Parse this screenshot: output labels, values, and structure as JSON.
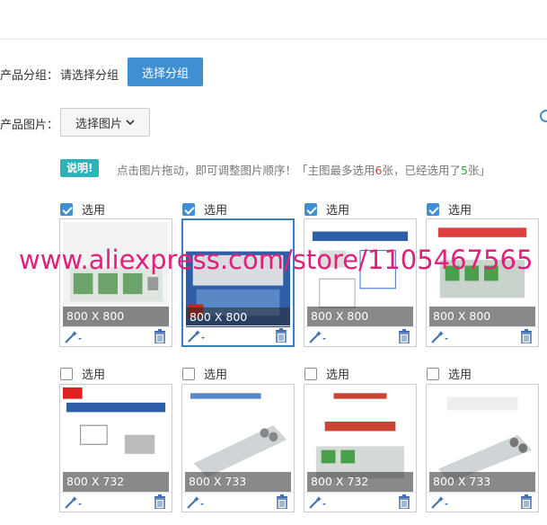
{
  "form": {
    "group_label": "产品分组：",
    "group_placeholder": "请选择分组",
    "group_button": "选择分组",
    "image_label": "产品图片：",
    "image_button": "选择图片"
  },
  "hint": {
    "badge": "说明!",
    "text_a": "点击图片拖动，即可调整图片顺序！「主图最多选用",
    "max_count": "6",
    "text_b": "张，已经选用了",
    "used_count": "5",
    "text_c": "张」"
  },
  "watermark": "www.aliexpress.com/store/1105467565",
  "select_label": "选用",
  "images": [
    {
      "checked": true,
      "size": "800 X 800",
      "selected": false
    },
    {
      "checked": true,
      "size": "800 X 800",
      "selected": true
    },
    {
      "checked": true,
      "size": "800 X 800",
      "selected": false
    },
    {
      "checked": true,
      "size": "800 X 800",
      "selected": false
    },
    {
      "checked": false,
      "size": "800 X 732",
      "selected": false
    },
    {
      "checked": false,
      "size": "800 X 733",
      "selected": false
    },
    {
      "checked": false,
      "size": "800 X 732",
      "selected": false
    },
    {
      "checked": false,
      "size": "800 X 733",
      "selected": false
    }
  ],
  "icons": {
    "edit": "magic-wand-icon",
    "delete": "trash-icon",
    "dropdown": "chevron-down-icon"
  },
  "colors": {
    "primary": "#3f8fd2",
    "badge": "#2bb3b8",
    "highlight_red": "#e4393c",
    "highlight_green": "#36a335",
    "watermark": "#e0207a"
  }
}
